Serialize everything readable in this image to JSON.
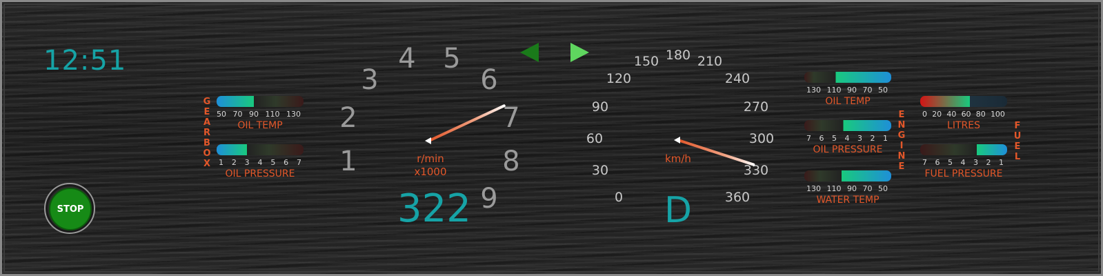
{
  "clock": "12:51",
  "stop_button": "STOP",
  "gearbox": {
    "title_letters": [
      "G",
      "E",
      "A",
      "R",
      "B",
      "O",
      "X"
    ],
    "oil_temp": {
      "label": "OIL TEMP",
      "ticks": [
        "50",
        "70",
        "90",
        "110",
        "130"
      ],
      "level": 0.43
    },
    "oil_pressure": {
      "label": "OIL PRESSURE",
      "ticks": [
        "1",
        "2",
        "3",
        "4",
        "5",
        "6",
        "7"
      ],
      "level": 0.35
    }
  },
  "tachometer": {
    "numbers": [
      "1",
      "2",
      "3",
      "4",
      "5",
      "6",
      "7",
      "8",
      "9"
    ],
    "unit_line1": "r/min",
    "unit_line2": "x1000",
    "value_display": "322"
  },
  "indicators": {
    "left": "turn-left-arrow",
    "right": "turn-right-arrow",
    "left_color": "#1a7a1a",
    "right_color": "#5fd65f"
  },
  "speedometer": {
    "numbers": [
      "0",
      "30",
      "60",
      "90",
      "120",
      "150",
      "180",
      "210",
      "240",
      "270",
      "300",
      "330",
      "360"
    ],
    "unit": "km/h",
    "gear_display": "D"
  },
  "engine": {
    "title_letters": [
      "E",
      "N",
      "G",
      "I",
      "N",
      "E"
    ],
    "oil_temp": {
      "label": "OIL TEMP",
      "ticks": [
        "130",
        "110",
        "90",
        "70",
        "50"
      ],
      "level": 0.64
    },
    "oil_pressure": {
      "label": "OIL PRESSURE",
      "ticks": [
        "7",
        "6",
        "5",
        "4",
        "3",
        "2",
        "1"
      ],
      "level": 0.55
    },
    "water_temp": {
      "label": "WATER TEMP",
      "ticks": [
        "130",
        "110",
        "90",
        "70",
        "50"
      ],
      "level": 0.57
    }
  },
  "fuel": {
    "title_letters": [
      "F",
      "U",
      "E",
      "L"
    ],
    "litres": {
      "label": "LITRES",
      "ticks": [
        "0",
        "20",
        "40",
        "60",
        "80",
        "100"
      ],
      "level": 0.57
    },
    "fuel_pressure": {
      "label": "FUEL PRESSURE",
      "ticks": [
        "7",
        "6",
        "5",
        "4",
        "3",
        "2",
        "1"
      ],
      "level": 0.35
    }
  },
  "colors": {
    "accent_cyan": "#16a3a6",
    "label_orange": "#e2572a",
    "stop_green": "#168a16"
  }
}
